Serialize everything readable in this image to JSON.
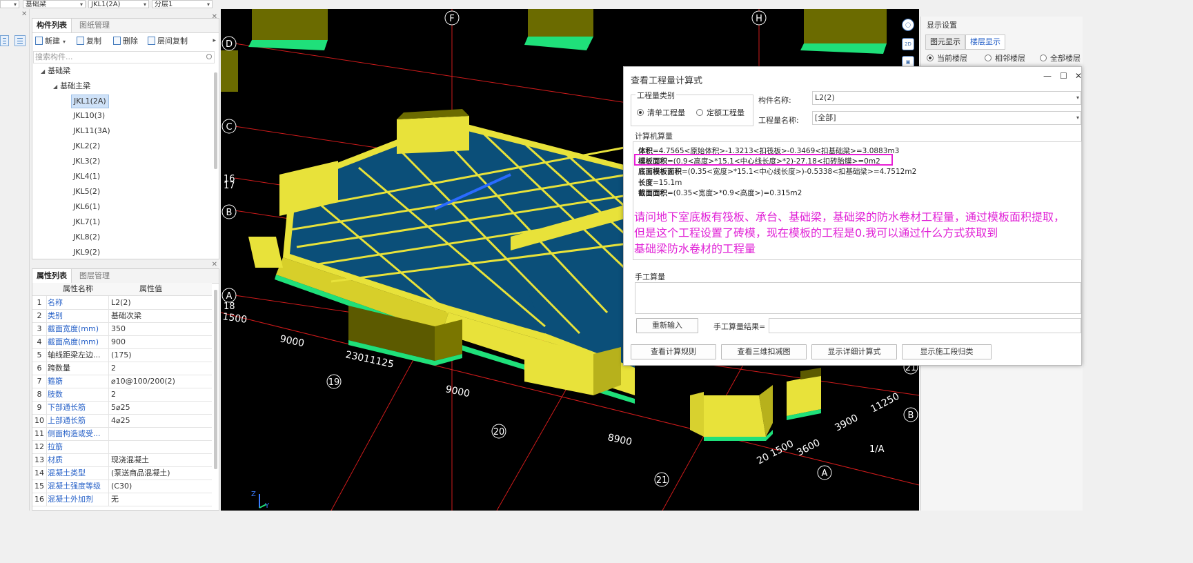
{
  "top_selectors": {
    "type": "基础梁",
    "component": "JKL1(2A)",
    "layer": "分层1"
  },
  "component_panel": {
    "tabs": [
      "构件列表",
      "图纸管理"
    ],
    "toolbar": {
      "new": "新建",
      "copy": "复制",
      "delete": "删除",
      "floor_copy": "层间复制"
    },
    "search_placeholder": "搜索构件...",
    "tree": {
      "root": "基础梁",
      "child": "基础主梁",
      "items": [
        "JKL1(2A)",
        "JKL10(3)",
        "JKL11(3A)",
        "JKL2(2)",
        "JKL3(2)",
        "JKL4(1)",
        "JKL5(2)",
        "JKL6(1)",
        "JKL7(1)",
        "JKL8(2)",
        "JKL9(2)"
      ],
      "selected": "JKL1(2A)"
    }
  },
  "property_panel": {
    "tabs": [
      "属性列表",
      "图层管理"
    ],
    "headers": [
      "属性名称",
      "属性值"
    ],
    "rows": [
      {
        "n": "1",
        "name": "名称",
        "value": "L2(2)"
      },
      {
        "n": "2",
        "name": "类别",
        "value": "基础次梁"
      },
      {
        "n": "3",
        "name": "截面宽度(mm)",
        "value": "350"
      },
      {
        "n": "4",
        "name": "截面高度(mm)",
        "value": "900"
      },
      {
        "n": "5",
        "name": "轴线距梁左边...",
        "value": "(175)"
      },
      {
        "n": "6",
        "name": "跨数量",
        "value": "2"
      },
      {
        "n": "7",
        "name": "箍筋",
        "value": "⌀10@100/200(2)"
      },
      {
        "n": "8",
        "name": "肢数",
        "value": "2"
      },
      {
        "n": "9",
        "name": "下部通长筋",
        "value": "5⌀25"
      },
      {
        "n": "10",
        "name": "上部通长筋",
        "value": "4⌀25"
      },
      {
        "n": "11",
        "name": "侧面构造或受...",
        "value": ""
      },
      {
        "n": "12",
        "name": "拉筋",
        "value": ""
      },
      {
        "n": "13",
        "name": "材质",
        "value": "现浇混凝土"
      },
      {
        "n": "14",
        "name": "混凝土类型",
        "value": "(泵送商品混凝土)"
      },
      {
        "n": "15",
        "name": "混凝土强度等级",
        "value": "(C30)"
      },
      {
        "n": "16",
        "name": "混凝土外加剂",
        "value": "无"
      }
    ]
  },
  "viewport": {
    "axis_labels": [
      "F",
      "H",
      "D",
      "C",
      "16",
      "17",
      "B",
      "A",
      "18",
      "19",
      "20",
      "21",
      "21",
      "B",
      "1/A",
      "A"
    ],
    "dimensions": [
      "1500",
      "9000",
      "23011125",
      "9000",
      "8900",
      "20 1500",
      "3600",
      "3900",
      "11250"
    ],
    "axes_gizmo": {
      "z": "Z",
      "y": "Y"
    }
  },
  "display_settings": {
    "title": "显示设置",
    "tabs": [
      "图元显示",
      "楼层显示"
    ],
    "options": [
      "当前楼层",
      "相邻楼层",
      "全部楼层"
    ],
    "selected": "当前楼层"
  },
  "view_tools": {
    "2d": "2D"
  },
  "dialog": {
    "title": "查看工程量计算式",
    "controls": {
      "minimize": "—",
      "maximize": "☐",
      "close": "✕"
    },
    "quantity_type_group": "工程量类别",
    "quantity_types": [
      "清单工程量",
      "定额工程量"
    ],
    "selected_type": "清单工程量",
    "component_name_label": "构件名称:",
    "component_name_value": "L2(2)",
    "quantity_name_label": "工程量名称:",
    "quantity_name_value": "[全部]",
    "calc_group": "计算机算量",
    "calc_lines": [
      {
        "key": "体积",
        "rest": "=4.7565<原始体积>-1.3213<扣筏板>-0.3469<扣基础梁>=3.0883m3"
      },
      {
        "key": "模板面积",
        "rest": "=(0.9<高度>*15.1<中心线长度>*2)-27.18<扣砖胎膜>=0m2"
      },
      {
        "key": "底面模板面积",
        "rest": "=(0.35<宽度>*15.1<中心线长度>)-0.5338<扣基础梁>=4.7512m2"
      },
      {
        "key": "长度",
        "rest": "=15.1m"
      },
      {
        "key": "截面面积",
        "rest": "=(0.35<宽度>*0.9<高度>)=0.315m2"
      }
    ],
    "question_lines": [
      "请问地下室底板有筏板、承台、基础梁，基础梁的防水卷材工程量，通过模板面积提取，",
      "但是这个工程设置了砖模，现在模板的工程是0.我可以通过什么方式获取到",
      "基础梁防水卷材的工程量"
    ],
    "manual_group": "手工算量",
    "reinput_button": "重新输入",
    "manual_result_label": "手工算量结果=",
    "buttons": [
      "查看计算规则",
      "查看三维扣减图",
      "显示详细计算式",
      "显示施工段归类"
    ],
    "highlight_color": "#e81ed6",
    "question_color": "#e021d6"
  },
  "colors": {
    "link_blue": "#2862c8",
    "beam_yellow": "#e8e23a",
    "raft_blue": "#0b4f79",
    "edge_green": "#1fe07a"
  }
}
